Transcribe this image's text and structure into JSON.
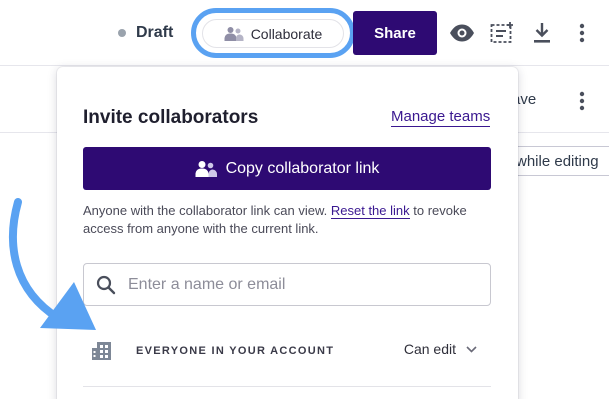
{
  "topbar": {
    "status_label": "Draft",
    "collaborate_label": "Collaborate",
    "share_label": "Share",
    "icons": [
      "preview-eye-icon",
      "template-icon",
      "download-icon",
      "more-vertical-icon"
    ]
  },
  "background": {
    "save_label": "ave",
    "editing_label": "while editing"
  },
  "popover": {
    "title": "Invite collaborators",
    "manage_teams_label": "Manage teams",
    "copy_link_label": "Copy collaborator link",
    "help_prefix": "Anyone with the collaborator link can view.",
    "reset_link_label": "Reset the link",
    "help_suffix": "to revoke access from anyone with the current link.",
    "search_placeholder": "Enter a name or email",
    "account_row": {
      "label": "EVERYONE IN YOUR ACCOUNT",
      "permission": "Can edit"
    }
  },
  "colors": {
    "brand_purple": "#2e0a73",
    "highlight_blue": "#5aa2f2",
    "link_purple": "#3a1890"
  }
}
